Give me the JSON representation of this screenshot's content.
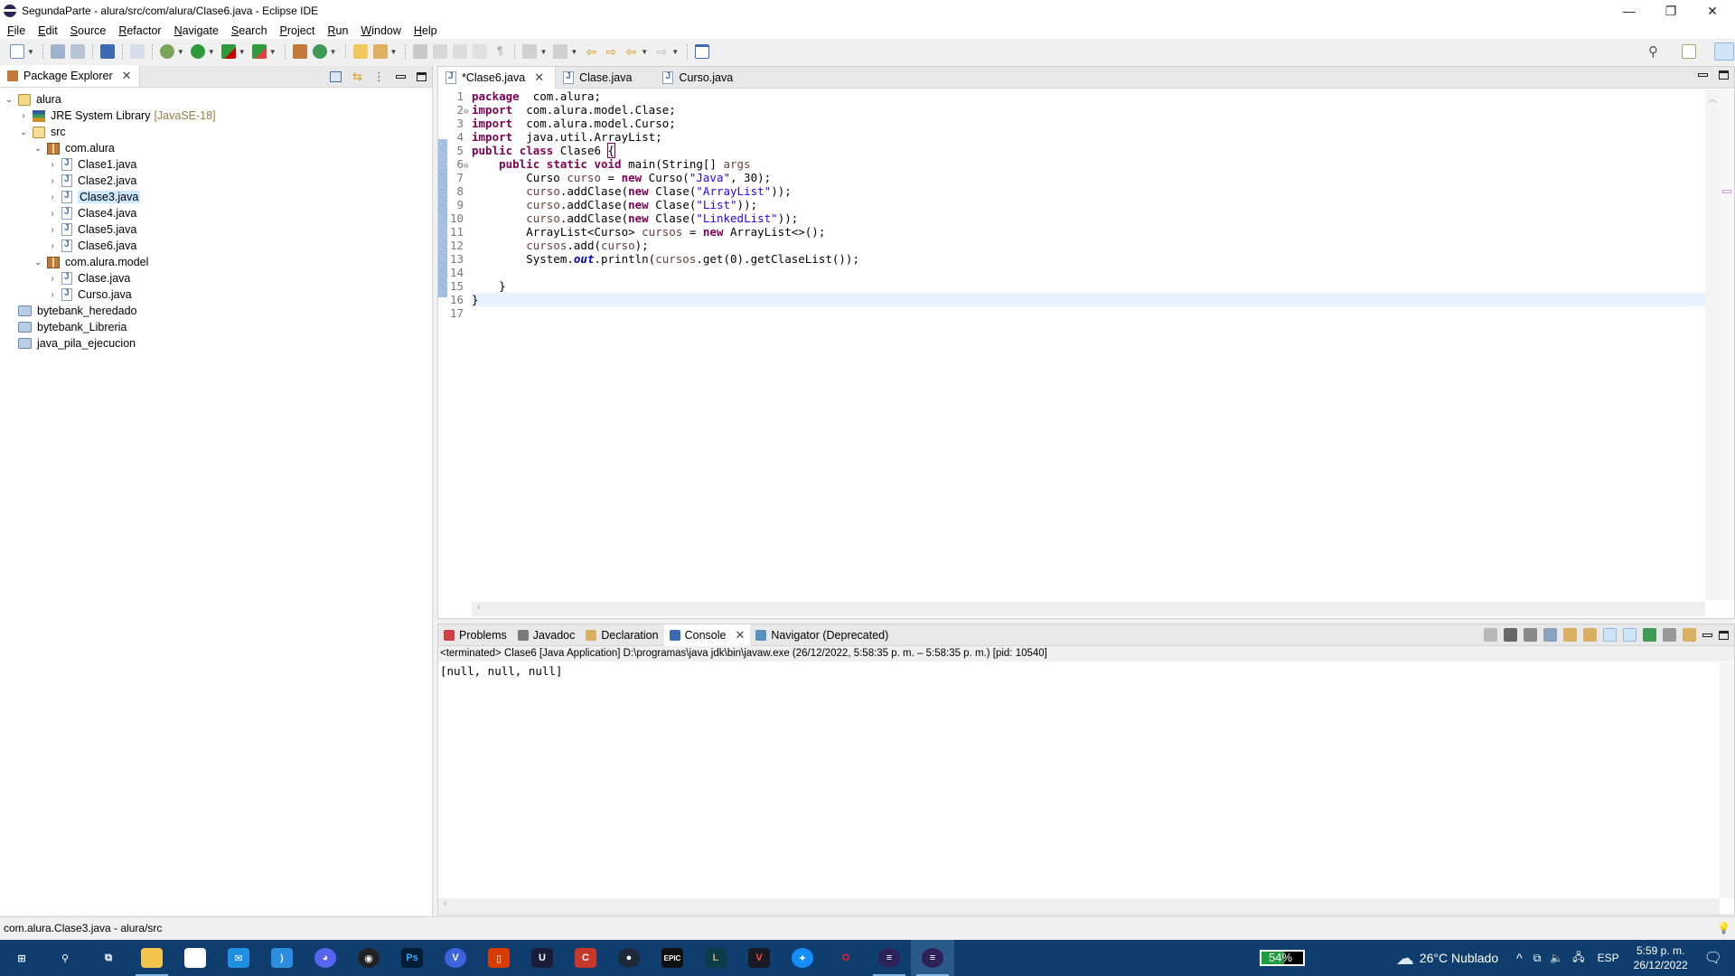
{
  "window": {
    "title": "SegundaParte - alura/src/com/alura/Clase6.java - Eclipse IDE",
    "controls": {
      "minimize": "—",
      "restore": "❐",
      "close": "✕"
    }
  },
  "menu": [
    "File",
    "Edit",
    "Source",
    "Refactor",
    "Navigate",
    "Search",
    "Project",
    "Run",
    "Window",
    "Help"
  ],
  "toolbar": {
    "icons": [
      "new-icon",
      "save-icon",
      "save-all-icon",
      "terminal-icon",
      "skip-breakpoints-icon",
      "debug-icon",
      "run-icon",
      "coverage-icon",
      "external-tools-icon",
      "new-package-icon",
      "new-class-icon",
      "open-type-icon",
      "search-icon",
      "annotation-icon",
      "edit-icon",
      "block-selection-icon",
      "show-whitespace-icon",
      "next-annotation-icon",
      "prev-annotation-icon",
      "last-edit-icon",
      "forward-edit-icon",
      "back-icon",
      "forward-icon",
      "pin-editor-icon"
    ],
    "right_icons": [
      "search-icon",
      "open-perspective-icon",
      "java-perspective-icon"
    ]
  },
  "package_explorer": {
    "tab_label": "Package Explorer",
    "tree": [
      {
        "label": "alura",
        "depth": 0,
        "type": "project",
        "expanded": true
      },
      {
        "label": "JRE System Library",
        "decoration": "[JavaSE-18]",
        "depth": 1,
        "type": "library",
        "expanded": false
      },
      {
        "label": "src",
        "depth": 1,
        "type": "src",
        "expanded": true
      },
      {
        "label": "com.alura",
        "depth": 2,
        "type": "package",
        "expanded": true
      },
      {
        "label": "Clase1.java",
        "depth": 3,
        "type": "java",
        "expanded": false
      },
      {
        "label": "Clase2.java",
        "depth": 3,
        "type": "java",
        "expanded": false
      },
      {
        "label": "Clase3.java",
        "depth": 3,
        "type": "java",
        "expanded": false,
        "selected": true
      },
      {
        "label": "Clase4.java",
        "depth": 3,
        "type": "java",
        "expanded": false
      },
      {
        "label": "Clase5.java",
        "depth": 3,
        "type": "java",
        "expanded": false
      },
      {
        "label": "Clase6.java",
        "depth": 3,
        "type": "java",
        "expanded": false
      },
      {
        "label": "com.alura.model",
        "depth": 2,
        "type": "package",
        "expanded": true
      },
      {
        "label": "Clase.java",
        "depth": 3,
        "type": "java",
        "expanded": false
      },
      {
        "label": "Curso.java",
        "depth": 3,
        "type": "java",
        "expanded": false
      },
      {
        "label": "bytebank_heredado",
        "depth": 0,
        "type": "folder"
      },
      {
        "label": "bytebank_Libreria",
        "depth": 0,
        "type": "folder"
      },
      {
        "label": "java_pila_ejecucion",
        "depth": 0,
        "type": "folder"
      }
    ]
  },
  "editor": {
    "tabs": [
      {
        "label": "*Clase6.java",
        "active": true,
        "closable": true
      },
      {
        "label": "Clase.java",
        "active": false
      },
      {
        "label": "Curso.java",
        "active": false
      }
    ],
    "current_line": 16,
    "lines": [
      {
        "n": "1",
        "code": [
          [
            "kw",
            "package"
          ],
          [
            "",
            "  com.alura;"
          ]
        ]
      },
      {
        "n": "2",
        "fold": true,
        "code": [
          [
            "kw",
            "import"
          ],
          [
            "",
            "  com.alura.model.Clase;"
          ]
        ]
      },
      {
        "n": "3",
        "code": [
          [
            "kw",
            "import"
          ],
          [
            "",
            "  com.alura.model.Curso;"
          ]
        ]
      },
      {
        "n": "4",
        "code": [
          [
            "kw",
            "import"
          ],
          [
            "",
            "  java.util.ArrayList;"
          ]
        ]
      },
      {
        "n": "5",
        "code": [
          [
            "kw",
            "public"
          ],
          [
            "",
            " "
          ],
          [
            "kw",
            "class"
          ],
          [
            "",
            " Clase6 "
          ],
          [
            "bracket",
            "{"
          ]
        ]
      },
      {
        "n": "6",
        "fold": true,
        "code": [
          [
            "",
            "    "
          ],
          [
            "kw",
            "public"
          ],
          [
            "",
            " "
          ],
          [
            "kw",
            "static"
          ],
          [
            "",
            " "
          ],
          [
            "kw",
            "void"
          ],
          [
            "",
            " main(String[] "
          ],
          [
            "var",
            "args"
          ],
          [
            ") {"
          ]
        ]
      },
      {
        "n": "7",
        "code": [
          [
            "",
            "        Curso "
          ],
          [
            "var",
            "curso"
          ],
          [
            "",
            " = "
          ],
          [
            "kw",
            "new"
          ],
          [
            "",
            " Curso("
          ],
          [
            "str",
            "\"Java\""
          ],
          [
            "",
            ", 30);"
          ]
        ]
      },
      {
        "n": "8",
        "code": [
          [
            "",
            "        "
          ],
          [
            "var",
            "curso"
          ],
          [
            "",
            ".addClase("
          ],
          [
            "kw",
            "new"
          ],
          [
            "",
            " Clase("
          ],
          [
            "str",
            "\"ArrayList\""
          ],
          [
            "",
            "));"
          ]
        ]
      },
      {
        "n": "9",
        "code": [
          [
            "",
            "        "
          ],
          [
            "var",
            "curso"
          ],
          [
            "",
            ".addClase("
          ],
          [
            "kw",
            "new"
          ],
          [
            "",
            " Clase("
          ],
          [
            "str",
            "\"List\""
          ],
          [
            "",
            "));"
          ]
        ]
      },
      {
        "n": "10",
        "code": [
          [
            "",
            "        "
          ],
          [
            "var",
            "curso"
          ],
          [
            "",
            ".addClase("
          ],
          [
            "kw",
            "new"
          ],
          [
            "",
            " Clase("
          ],
          [
            "str",
            "\"LinkedList\""
          ],
          [
            "",
            "));"
          ]
        ]
      },
      {
        "n": "11",
        "code": [
          [
            "",
            "        ArrayList<Curso> "
          ],
          [
            "var",
            "cursos"
          ],
          [
            "",
            " = "
          ],
          [
            "kw",
            "new"
          ],
          [
            "",
            " ArrayList<>();"
          ]
        ]
      },
      {
        "n": "12",
        "code": [
          [
            "",
            "        "
          ],
          [
            "var",
            "cursos"
          ],
          [
            "",
            ".add("
          ],
          [
            "var",
            "curso"
          ],
          [
            "",
            ");"
          ]
        ]
      },
      {
        "n": "13",
        "code": [
          [
            "",
            "        System."
          ],
          [
            "static",
            "out"
          ],
          [
            "",
            ".println("
          ],
          [
            "var",
            "cursos"
          ],
          [
            "",
            ".get(0).getClaseList());"
          ]
        ]
      },
      {
        "n": "14",
        "code": []
      },
      {
        "n": "15",
        "code": [
          [
            "",
            "    }"
          ]
        ]
      },
      {
        "n": "16",
        "code": [
          [
            "",
            "}"
          ]
        ]
      },
      {
        "n": "17",
        "code": []
      }
    ]
  },
  "console": {
    "tabs": [
      {
        "label": "Problems",
        "icon": "problems-icon"
      },
      {
        "label": "Javadoc",
        "icon": "javadoc-icon"
      },
      {
        "label": "Declaration",
        "icon": "declaration-icon"
      },
      {
        "label": "Console",
        "icon": "console-icon",
        "active": true,
        "closable": true
      },
      {
        "label": "Navigator (Deprecated)",
        "icon": "navigator-icon"
      }
    ],
    "tool_icons": [
      "terminate-icon",
      "remove-launch-icon",
      "remove-all-launches-icon",
      "clear-console-icon",
      "scroll-lock-icon",
      "word-wrap-icon",
      "show-on-stdout-icon",
      "show-on-stderr-icon",
      "pin-console-icon",
      "display-console-icon",
      "open-console-icon"
    ],
    "info": "<terminated> Clase6 [Java Application] D:\\programas\\java jdk\\bin\\javaw.exe  (26/12/2022, 5:58:35 p. m. – 5:58:35 p. m.) [pid: 10540]",
    "output": "[null, null, null]"
  },
  "status_bar": {
    "text": "com.alura.Clase3.java - alura/src"
  },
  "taskbar": {
    "apps": [
      "start-icon",
      "search-icon",
      "task-view-icon",
      "file-explorer-icon",
      "store-icon",
      "mail-icon",
      "vscode-icon",
      "discord-icon",
      "obs-icon",
      "photoshop-icon",
      "v-app-icon",
      "office-icon",
      "u-app-icon",
      "ccleaner-icon",
      "steam-icon",
      "epic-games-icon",
      "league-icon",
      "valorant-icon",
      "battlenet-icon",
      "opera-icon",
      "eclipse-icon",
      "eclipse-active-icon"
    ],
    "battery": "54%",
    "battery_level": 0.54,
    "weather": "26°C  Nublado",
    "language": "ESP",
    "time": "5:59 p. m.",
    "date": "26/12/2022"
  },
  "colors": {
    "keyword": "#7f0055",
    "string": "#2a00ff",
    "variable": "#6a3e3e",
    "static_field": "#0000c0",
    "selection": "#cce8ff",
    "current_line": "#e8f2fe",
    "taskbar": "#0f3e6e"
  }
}
